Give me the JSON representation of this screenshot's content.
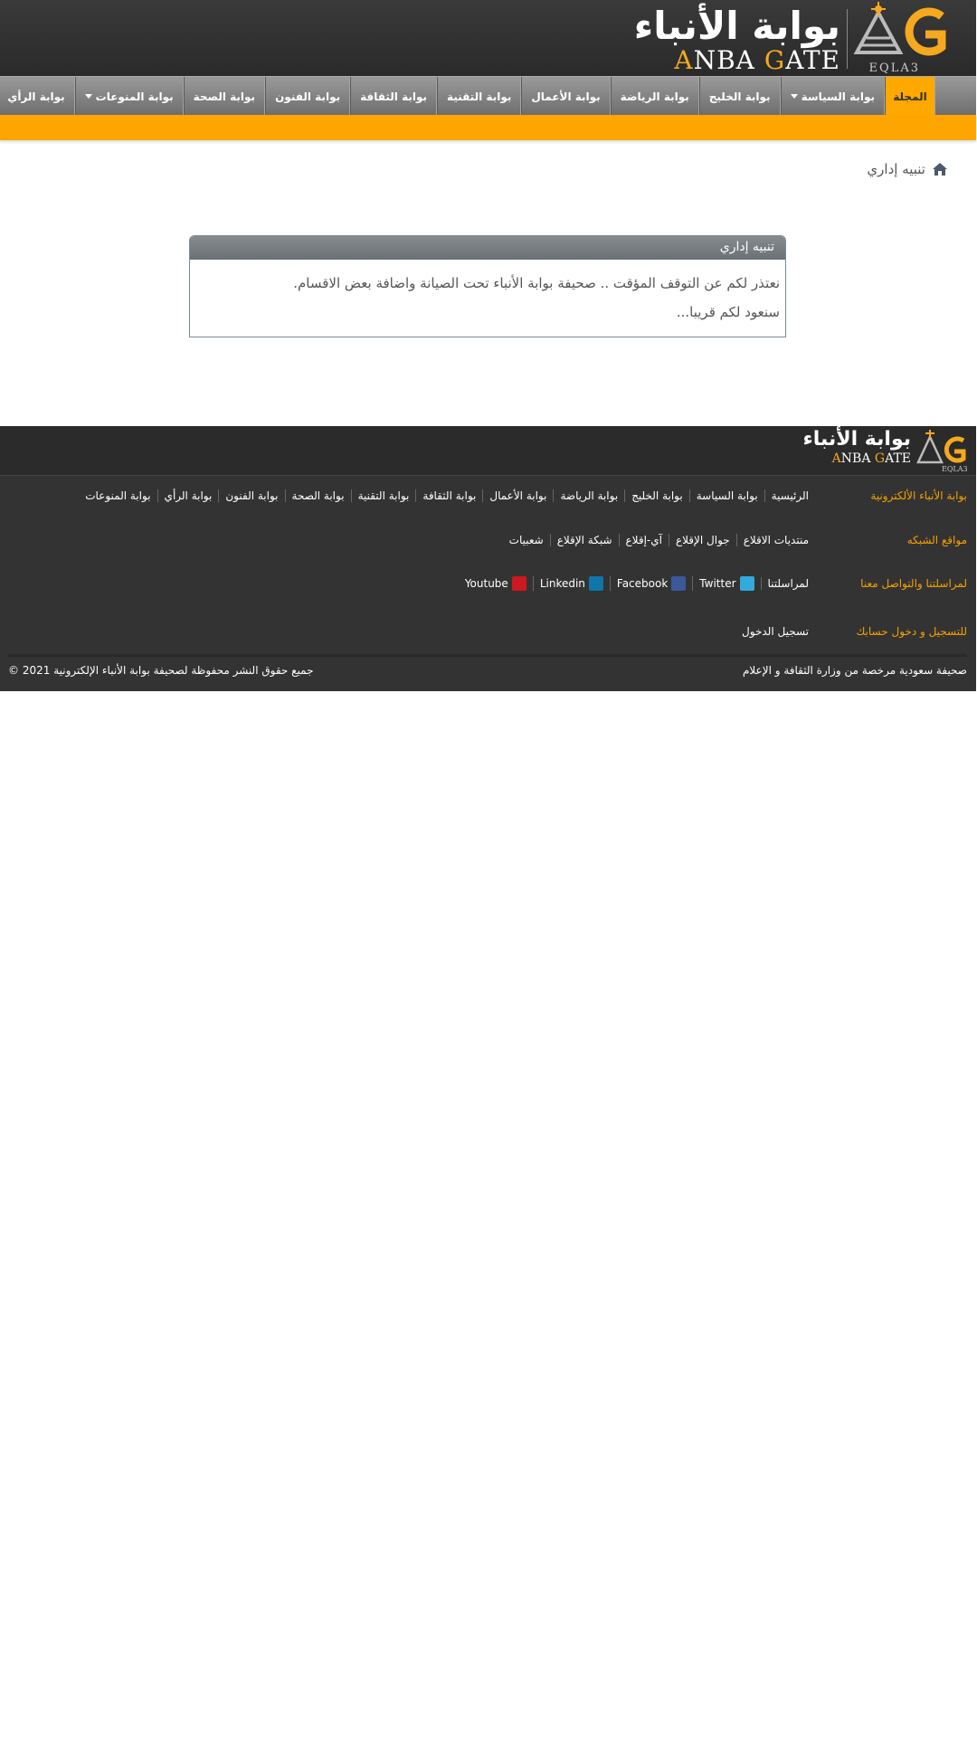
{
  "header": {
    "logo_ar": "بوابة الأنباء",
    "logo_en_first": "A",
    "logo_en_mid": "NBA ",
    "logo_en_g": "G",
    "logo_en_rest": "ATE",
    "logo_sub": "EQLA3"
  },
  "nav": {
    "items": [
      {
        "label": "المجلة",
        "active": true
      },
      {
        "label": "بوابة السياسة",
        "dropdown": true
      },
      {
        "label": "بوابة الخليج"
      },
      {
        "label": "بوابة الرياضة"
      },
      {
        "label": "بوابة الأعمال"
      },
      {
        "label": "بوابة التقنية"
      },
      {
        "label": "بوابة الثقافة"
      },
      {
        "label": "بوابة الفنون"
      },
      {
        "label": "بوابة الصحة"
      },
      {
        "label": "بوابة المنوعات",
        "dropdown": true
      },
      {
        "label": "بوابة الرأي"
      }
    ]
  },
  "breadcrumb": {
    "label": "تنبيه إداري"
  },
  "notice": {
    "title": "تنبيه إداري",
    "line1": "نعتذر لكم عن التوقف المؤقت .. صحيفة بوابة الأنباء تحت الصيانة واضافة بعض الاقسام.",
    "line2": "سنعود لكم قريبا..."
  },
  "footer": {
    "logo_ar": "بوابة الأنباء",
    "logo_en_first": "A",
    "logo_en_mid": "NBA ",
    "logo_en_g": "G",
    "logo_en_rest": "ATE",
    "logo_sub": "EQLA3",
    "rows": [
      {
        "label": "بوابة الأنباء الألكترونية",
        "links": [
          "الرئيسية",
          "بوابة السياسة",
          "بوابة الخليج",
          "بوابة الرياضة",
          "بوابة الأعمال",
          "بوابة الثقافة",
          "بوابة التقنية",
          "بوابة الصحة",
          "بوابة الفنون",
          "بوابة الرأي",
          "بوابة المنوعات"
        ]
      },
      {
        "label": "مواقع الشبكه",
        "links": [
          "منتديات الاقلاع",
          "جوال الإقلاع",
          "آي-إقلاع",
          "شبكة الإقلاع",
          "شعبيات"
        ]
      },
      {
        "label": "لمراسلتنا والتواصل معنا",
        "contact": "لمراسلتنا",
        "social": [
          {
            "label": "Twitter",
            "icon": "twitter-icon",
            "color": "#33aadd"
          },
          {
            "label": "Facebook",
            "icon": "facebook-icon",
            "color": "#3b5998"
          },
          {
            "label": "Linkedin",
            "icon": "linkedin-icon",
            "color": "#0e76a8"
          },
          {
            "label": "Youtube",
            "icon": "youtube-icon",
            "color": "#cc181e"
          }
        ]
      },
      {
        "label": "للتسجيل و دخول حسابك",
        "links": [
          "تسجيل الدخول"
        ]
      }
    ],
    "license": "صحيفة سعودية مرخصة من وزارة الثقافة و الإعلام",
    "copyright": "جميع حقوق النشر محفوظة لصحيفة بوابة الأنباء الإلكترونية 2021 ©"
  },
  "colors": {
    "accent": "#ffa500",
    "header_bg": "#2f2f2f",
    "footer_bg": "#333333",
    "footer_label": "#f5a000"
  }
}
